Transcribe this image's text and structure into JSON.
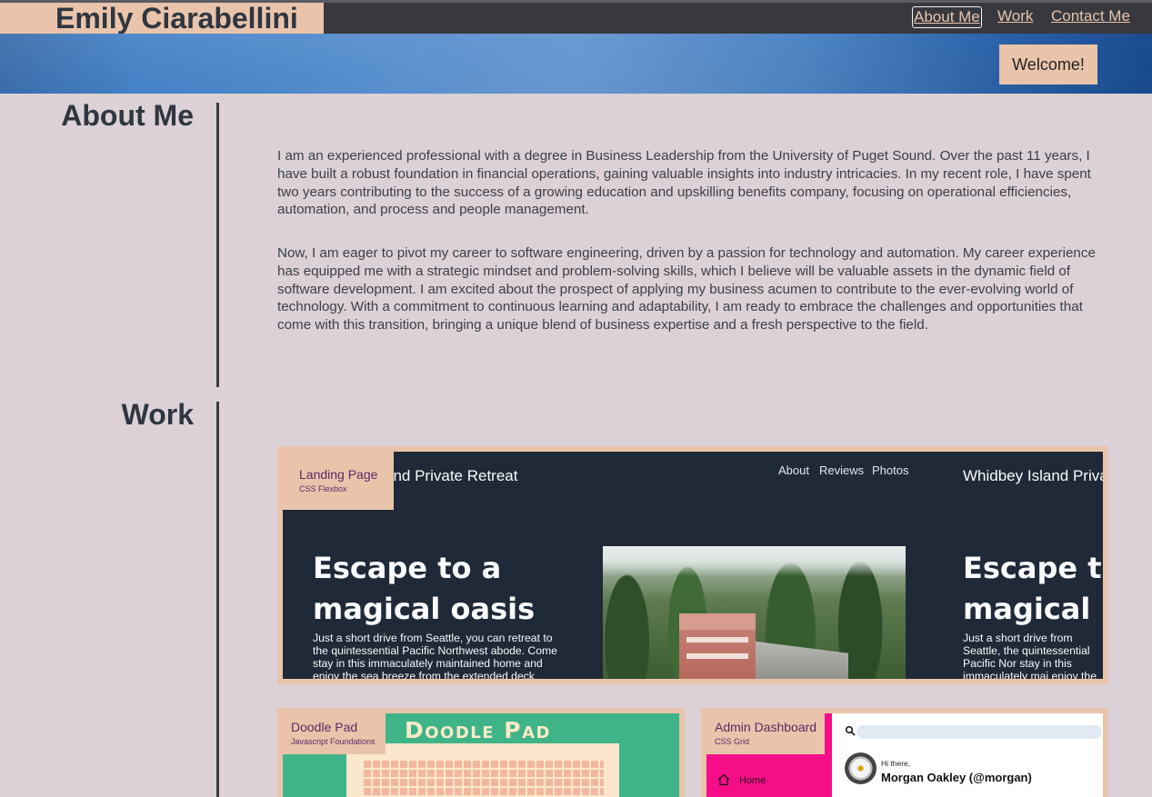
{
  "header": {
    "name": "Emily Ciarabellini",
    "nav": [
      "About Me",
      "Work",
      "Contact Me"
    ],
    "welcome": "Welcome!"
  },
  "about": {
    "title": "About Me",
    "paragraphs": [
      "I am an experienced professional with a degree in Business Leadership from the University of Puget Sound. Over the past 11 years, I have built a robust foundation in financial operations, gaining valuable insights into industry intricacies. In my recent role, I have spent two years contributing to the success of a growing education and upskilling benefits company, focusing on operational efficiencies, automation, and process and people management.",
      "Now, I am eager to pivot my career to software engineering, driven by a passion for technology and automation. My career experience has equipped me with a strategic mindset and problem-solving skills, which I believe will be valuable assets in the dynamic field of software development. I am excited about the prospect of applying my business acumen to contribute to the ever-evolving world of technology. With a commitment to continuous learning and adaptability, I am ready to embrace the challenges and opportunities that come with this transition, bringing a unique blend of business expertise and a fresh perspective to the field."
    ]
  },
  "work": {
    "title": "Work",
    "projects": [
      {
        "title": "Landing Page",
        "subtitle": "CSS Flexbox",
        "preview": {
          "brand": "and Private Retreat",
          "brand_repeat": "Whidbey Island Privat",
          "nav": [
            "About",
            "Reviews",
            "Photos"
          ],
          "headline_line1": "Escape to a",
          "headline_line2": "magical oasis",
          "headline_repeat_line1": "Escape t",
          "headline_repeat_line2": "magical",
          "body": "Just a short drive from Seattle, you can retreat to the quintessential Pacific Northwest abode. Come stay in this immaculately maintained home and enjoy the sea breeze from the extended deck.",
          "body_repeat": "Just a short drive from Seattle, the quintessential Pacific Nor stay in this immaculately mai enjoy the sea breeze from the"
        }
      },
      {
        "title": "Doodle Pad",
        "subtitle": "Javascript Foundations",
        "preview": {
          "heading": "Doodle Pad"
        }
      },
      {
        "title": "Admin Dashboard",
        "subtitle": "CSS Grid",
        "preview": {
          "greeting": "Hi there,",
          "user": "Morgan Oakley (@morgan)",
          "sidebar_item": "Home"
        }
      }
    ]
  },
  "colors": {
    "accent": "#e9c4ab",
    "background": "#dbd1d6",
    "dark": "#37393e",
    "label_text": "#5b2a66",
    "admin_sidebar": "#f50e88",
    "doodle_bg": "#3fb488"
  }
}
